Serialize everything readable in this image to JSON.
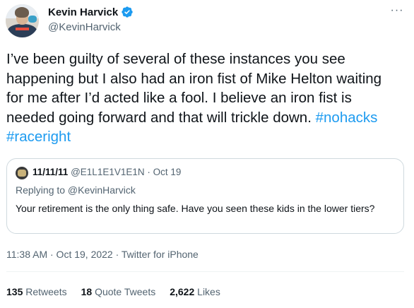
{
  "author": {
    "display_name": "Kevin Harvick",
    "handle": "@KevinHarvick",
    "verified": true
  },
  "tweet": {
    "text": "I’ve been guilty of several of these instances you see happening but I also had an iron fist of Mike Helton waiting for me after I’d acted like a fool. I believe an iron fist is needed going forward and that will trickle down.",
    "hashtags": [
      "#nohacks",
      "#raceright"
    ],
    "timestamp": "11:38 AM · Oct 19, 2022 · Twitter for iPhone"
  },
  "quoted_tweet": {
    "display_name": "11/11/11",
    "handle": "@E1L1E1V1E1N",
    "date": "· Oct 19",
    "replying_to": "Replying to @KevinHarvick",
    "text": "Your retirement is the only thing safe. Have you seen these kids in the lower tiers?"
  },
  "stats": [
    {
      "count": "135",
      "label": "Retweets"
    },
    {
      "count": "18",
      "label": "Quote Tweets"
    },
    {
      "count": "2,622",
      "label": "Likes"
    }
  ],
  "icons": {
    "more": "more-dots-icon",
    "verified": "verified-badge-icon"
  },
  "colors": {
    "accent": "#1d9bf0",
    "secondary_text": "#536471",
    "border": "#cfd9de"
  }
}
